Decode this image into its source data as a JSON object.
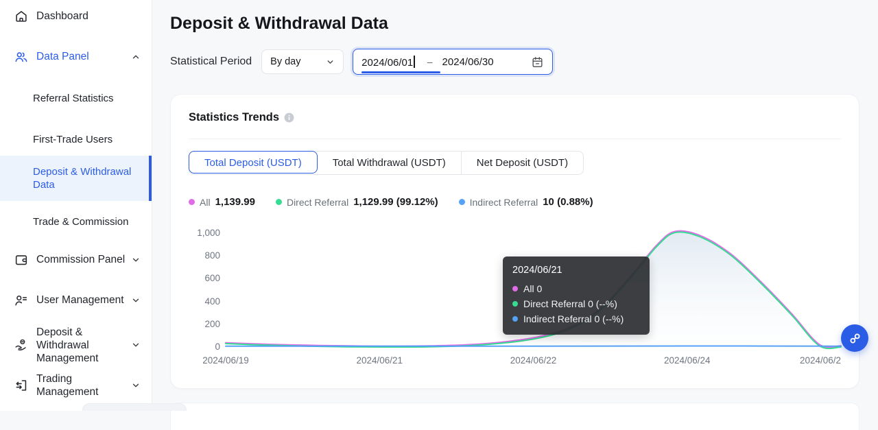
{
  "colors": {
    "accent": "#2B5CE6",
    "sidebar_selected_bg": "#EDF3FD",
    "page_bg": "#F7F8FA",
    "tooltip_bg": "#2D2F33",
    "all_series": "#E06CE8",
    "direct_series": "#35DC92",
    "indirect_series": "#54A1F6"
  },
  "icons": [
    "home-icon",
    "team-icon",
    "wallet-icon",
    "user-list-icon",
    "hand-coin-icon",
    "transfer-icon",
    "chevron-up-icon",
    "chevron-down-icon",
    "info-icon",
    "calendar-icon",
    "support-link-icon"
  ],
  "sidebar": {
    "items": [
      {
        "label": "Dashboard",
        "icon": "home-icon"
      },
      {
        "label": "Data Panel",
        "icon": "team-icon"
      },
      {
        "label": "Referral Statistics"
      },
      {
        "label": "First-Trade Users"
      },
      {
        "label": "Deposit & Withdrawal Data"
      },
      {
        "label": "Trade & Commission"
      },
      {
        "label": "Commission Panel",
        "icon": "wallet-icon"
      },
      {
        "label": "User Management",
        "icon": "user-list-icon"
      },
      {
        "label": "Deposit & Withdrawal Management",
        "icon": "hand-coin-icon"
      },
      {
        "label": "Trading Management",
        "icon": "transfer-icon"
      }
    ]
  },
  "page": {
    "title": "Deposit & Withdrawal Data"
  },
  "filters": {
    "label": "Statistical Period",
    "period": "By day",
    "date_start": "2024/06/01",
    "separator": "–",
    "date_end": "2024/06/30"
  },
  "trends": {
    "title": "Statistics Trends",
    "tabs": [
      {
        "label": "Total Deposit (USDT)"
      },
      {
        "label": "Total Withdrawal (USDT)"
      },
      {
        "label": "Net Deposit (USDT)"
      }
    ]
  },
  "tooltip": {
    "title": "2024/06/21",
    "rows": [
      {
        "text": "All 0"
      },
      {
        "text": "Direct Referral 0 (--%)"
      },
      {
        "text": "Indirect Referral 0 (--%)"
      }
    ]
  },
  "chart_data": {
    "type": "area",
    "title": "Statistics Trends — Total Deposit (USDT)",
    "x_ticks": [
      "2024/06/19",
      "2024/06/21",
      "2024/06/22",
      "2024/06/24",
      "2024/06/2"
    ],
    "x_range": [
      "2024/06/19",
      "2024/06/26"
    ],
    "y_ticks": [
      "1,000",
      "800",
      "600",
      "400",
      "200",
      "0"
    ],
    "ylim": [
      0,
      1000
    ],
    "grid": false,
    "legend_position": "top",
    "hovered_point": {
      "date": "2024/06/21",
      "all": 0,
      "direct": 0,
      "indirect": 0
    },
    "series": [
      {
        "name": "All",
        "total": "1,139.99",
        "color": "#E06CE8",
        "points": [
          [
            0,
            38
          ],
          [
            0.06,
            26
          ],
          [
            0.13,
            16
          ],
          [
            0.2,
            10
          ],
          [
            0.26,
            8
          ],
          [
            0.33,
            10
          ],
          [
            0.4,
            22
          ],
          [
            0.46,
            50
          ],
          [
            0.51,
            92
          ],
          [
            0.56,
            172
          ],
          [
            0.61,
            342
          ],
          [
            0.66,
            632
          ],
          [
            0.7,
            892
          ],
          [
            0.73,
            1015
          ],
          [
            0.77,
            982
          ],
          [
            0.82,
            822
          ],
          [
            0.87,
            572
          ],
          [
            0.92,
            292
          ],
          [
            0.965,
            22
          ],
          [
            1,
            10
          ]
        ]
      },
      {
        "name": "Direct Referral",
        "total": "1,129.99 (99.12%)",
        "color": "#35DC92",
        "area": true,
        "points": [
          [
            0,
            30
          ],
          [
            0.06,
            18
          ],
          [
            0.13,
            8
          ],
          [
            0.2,
            2
          ],
          [
            0.26,
            0
          ],
          [
            0.33,
            2
          ],
          [
            0.4,
            14
          ],
          [
            0.46,
            40
          ],
          [
            0.51,
            80
          ],
          [
            0.56,
            160
          ],
          [
            0.61,
            330
          ],
          [
            0.66,
            620
          ],
          [
            0.7,
            880
          ],
          [
            0.73,
            1005
          ],
          [
            0.77,
            970
          ],
          [
            0.82,
            810
          ],
          [
            0.87,
            560
          ],
          [
            0.92,
            280
          ],
          [
            0.965,
            10
          ],
          [
            1,
            0
          ]
        ]
      },
      {
        "name": "Indirect Referral",
        "total": "10 (0.88%)",
        "color": "#54A1F6",
        "points": [
          [
            0,
            8
          ],
          [
            0.25,
            8
          ],
          [
            0.5,
            8
          ],
          [
            0.75,
            9
          ],
          [
            1,
            8
          ]
        ]
      }
    ]
  }
}
